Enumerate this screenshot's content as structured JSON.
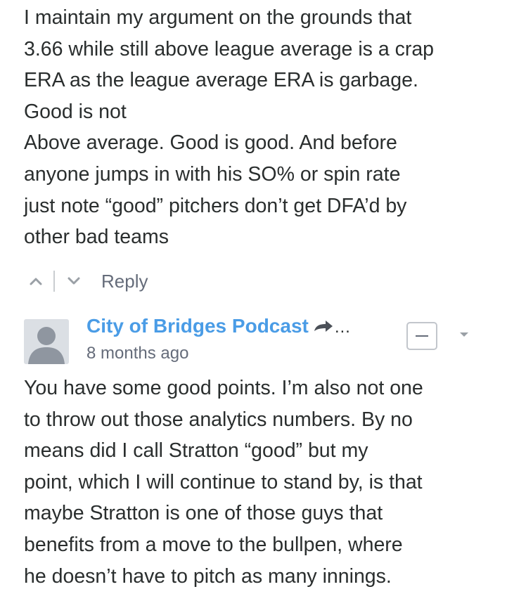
{
  "first_comment": {
    "lines": [
      "I maintain my argument on the grounds that",
      "3.66 while still above league average is a crap",
      "ERA as the league average ERA is garbage.",
      "Good is not",
      "Above average. Good is good. And before",
      "anyone jumps in with his SO% or spin rate",
      "just note “good” pitchers don’t get DFA’d by",
      "other bad teams"
    ]
  },
  "actions": {
    "upvote_icon": "chevron-up-icon",
    "downvote_icon": "chevron-down-icon",
    "reply_label": "Reply"
  },
  "second_comment": {
    "author": "City of Bridges Podcast",
    "author_suffix": "…",
    "timestamp": "8 months ago",
    "collapse_icon": "minus-icon",
    "menu_icon": "caret-down-icon",
    "lines": [
      "You have some good points. I’m also not one",
      "to throw out those analytics numbers. By no",
      "means did I call Stratton “good” but my",
      "point, which I will continue to stand by, is that",
      "maybe Stratton is one of those guys that",
      "benefits from a move to the bullpen, where",
      "he doesn’t have to pitch as many innings."
    ]
  },
  "colors": {
    "text": "#2a2e2e",
    "author_link": "#4a9ce6",
    "muted": "#656c7a",
    "avatar_bg": "#dbdfe4",
    "avatar_fg": "#8f96a0"
  }
}
